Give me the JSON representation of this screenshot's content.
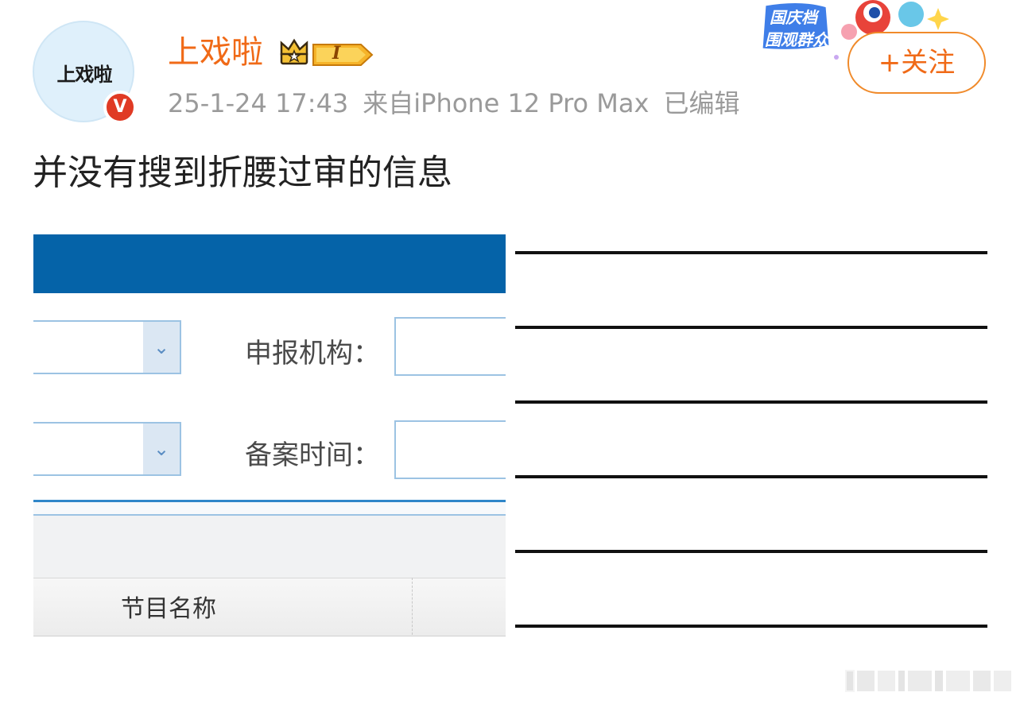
{
  "user": {
    "name": "上戏啦",
    "avatar_text": "上戏啦",
    "verified_mark": "V",
    "level": "I"
  },
  "post_meta": {
    "date": "25-1-24 17:43",
    "source": "来自iPhone 12 Pro Max",
    "edited": "已编辑"
  },
  "follow_button": "+关注",
  "decoration": {
    "line1": "国庆档",
    "line2": "围观群众"
  },
  "post_text": "并没有搜到折腰过审的信息",
  "embedded_screenshot": {
    "field1_label": "申报机构：",
    "field2_label": "备案时间：",
    "column_header": "节目名称",
    "dropdown_icon": "chevron-down-icon"
  },
  "colors": {
    "username": "#f06a17",
    "follow_border": "#f08a2a",
    "verified": "#e03a24",
    "screenshot_bar": "#0563a8"
  }
}
